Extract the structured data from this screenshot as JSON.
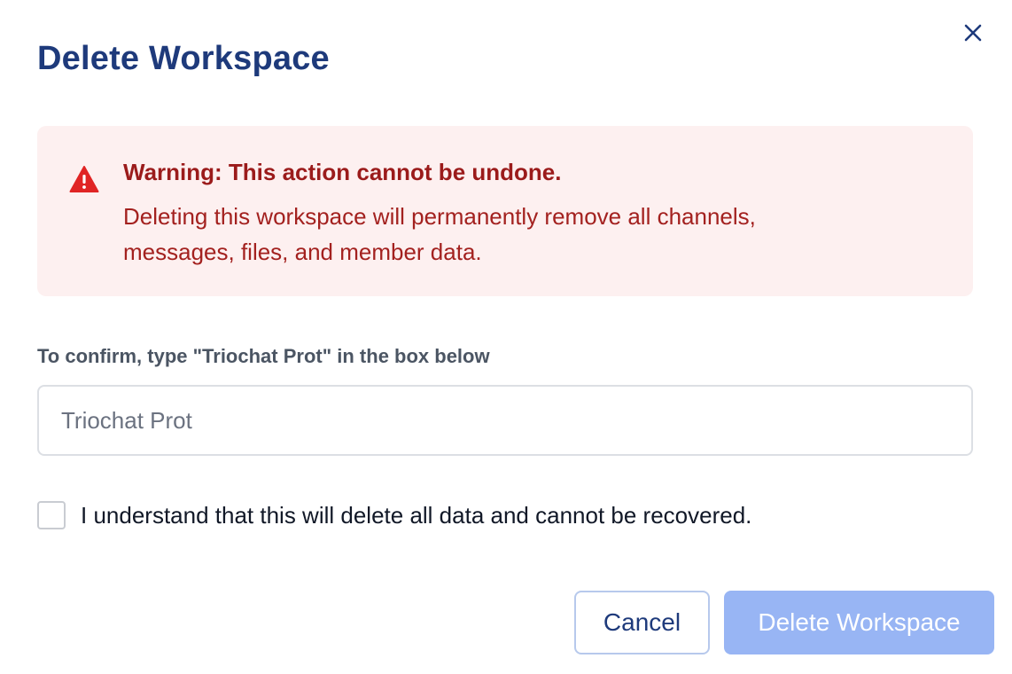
{
  "dialog": {
    "title": "Delete Workspace",
    "close_icon": "close-icon"
  },
  "warning": {
    "icon": "warning-triangle-icon",
    "title": "Warning: This action cannot be undone.",
    "message_line1": "Deleting this workspace will permanently remove all channels,",
    "message_line2": "messages, files, and member data."
  },
  "confirm": {
    "label": "To confirm, type \"Triochat Prot\" in the box below",
    "value": "",
    "placeholder": "Triochat Prot"
  },
  "acknowledge": {
    "checked": false,
    "label": "I understand that this will delete all data and cannot be recovered."
  },
  "actions": {
    "cancel_label": "Cancel",
    "delete_label": "Delete Workspace",
    "delete_disabled": true
  },
  "colors": {
    "title": "#1e3a7b",
    "warning_bg": "#fdf0f0",
    "warning_text": "#9b1b1b",
    "warning_icon": "#e02424",
    "delete_button_disabled": "#98b5f4"
  }
}
